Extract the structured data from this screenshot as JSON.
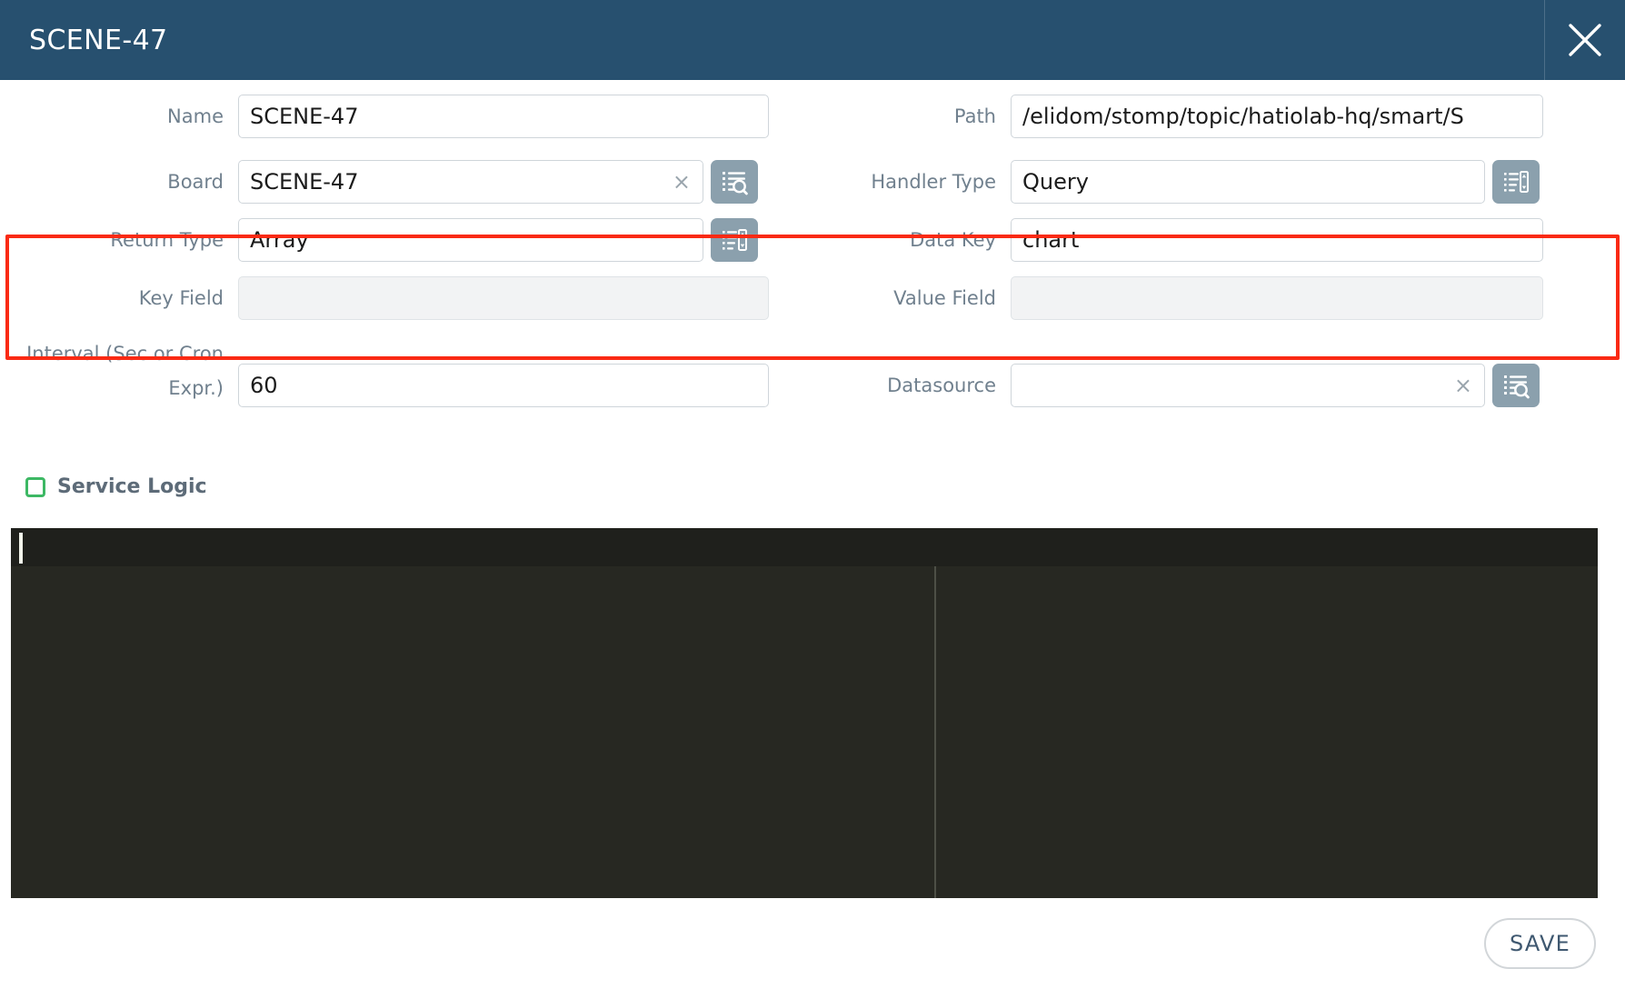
{
  "titlebar": {
    "title": "SCENE-47",
    "close_icon": "close-icon"
  },
  "form": {
    "name": {
      "label": "Name",
      "value": "SCENE-47",
      "placeholder": ""
    },
    "path": {
      "label": "Path",
      "value": "/elidom/stomp/topic/hatiolab-hq/smart/S",
      "placeholder": ""
    },
    "board": {
      "label": "Board",
      "value": "SCENE-47",
      "placeholder": "",
      "clear_label": "×",
      "picker_icon": "list-search-icon"
    },
    "handler_type": {
      "label": "Handler Type",
      "value": "Query",
      "placeholder": "",
      "picker_icon": "list-select-icon"
    },
    "return_type": {
      "label": "Return Type",
      "value": "Array",
      "placeholder": "",
      "picker_icon": "list-select-icon"
    },
    "data_key": {
      "label": "Data Key",
      "value": "chart",
      "placeholder": ""
    },
    "key_field": {
      "label": "Key Field",
      "value": "",
      "placeholder": ""
    },
    "value_field": {
      "label": "Value Field",
      "value": "",
      "placeholder": ""
    },
    "interval": {
      "label": "Interval (Sec or Cron Expr.)",
      "value": "60",
      "placeholder": ""
    },
    "datasource": {
      "label": "Datasource",
      "value": "",
      "placeholder": "",
      "clear_label": "×",
      "picker_icon": "list-search-icon"
    }
  },
  "service_logic": {
    "label": "Service Logic",
    "checked": false,
    "checkbox_icon": "checkbox-unchecked-icon"
  },
  "editor": {
    "content": "",
    "caret_visible": true
  },
  "footer": {
    "save_label": "SAVE"
  },
  "colors": {
    "header_bg": "#27506f",
    "highlight_border": "#fa2a14",
    "checkbox_green": "#3db864",
    "icon_button_bg": "#8ba0ad",
    "editor_bg": "#272822",
    "save_text": "#3f5870"
  }
}
